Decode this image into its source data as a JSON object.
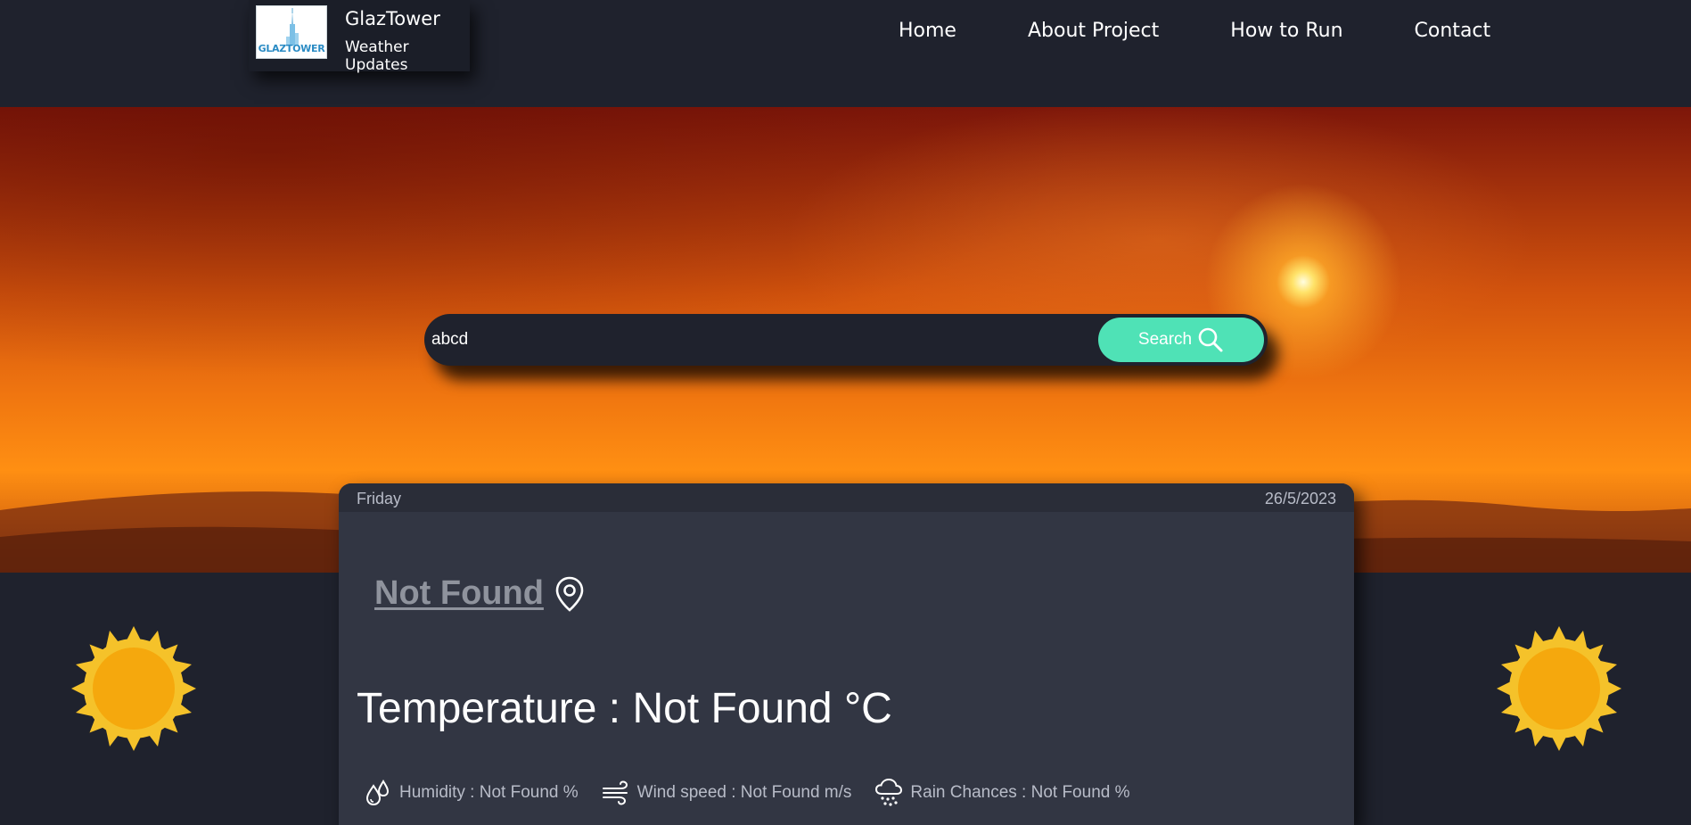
{
  "brand": {
    "logo_text": "GLAZTOWER",
    "title": "GlazTower",
    "subtitle": "Weather Updates"
  },
  "nav": {
    "items": [
      {
        "label": "Home"
      },
      {
        "label": "About Project"
      },
      {
        "label": "How to Run"
      },
      {
        "label": "Contact"
      }
    ]
  },
  "search": {
    "value": "abcd",
    "button_label": "Search",
    "button_icon": "search-icon",
    "colors": {
      "button": "#4fe2b6",
      "bar": "#1f222d"
    }
  },
  "card": {
    "day": "Friday",
    "date": "26/5/2023",
    "location": "Not Found",
    "location_icon": "map-pin-icon",
    "temperature": "Temperature : Not Found °C",
    "stats": [
      {
        "icon": "humidity-icon",
        "label": "Humidity : Not Found %"
      },
      {
        "icon": "wind-icon",
        "label": "Wind speed : Not Found m/s"
      },
      {
        "icon": "rain-cloud-icon",
        "label": "Rain Chances : Not Found %"
      }
    ]
  },
  "decor": {
    "sun_icon": "sun-icon",
    "sun_colors": {
      "outer": "#f5c22a",
      "inner": "#f5a80d"
    }
  }
}
